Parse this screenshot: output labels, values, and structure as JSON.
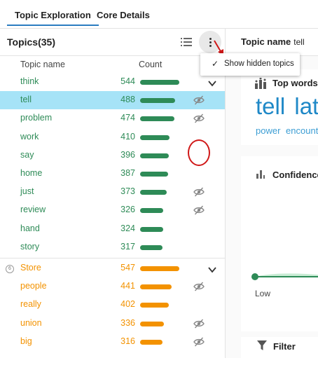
{
  "tabs": [
    {
      "label": "Topic Exploration",
      "active": true
    },
    {
      "label": "Core Details",
      "active": false
    }
  ],
  "left_panel": {
    "title": "Topics(35)",
    "columns": {
      "name": "Topic name",
      "count": "Count"
    }
  },
  "topics": [
    {
      "name": "think",
      "count": "544",
      "value": 544,
      "hidden": false,
      "selected": false,
      "expand": true
    },
    {
      "name": "tell",
      "count": "488",
      "value": 488,
      "hidden": true,
      "selected": true
    },
    {
      "name": "problem",
      "count": "474",
      "value": 474,
      "hidden": true,
      "selected": false,
      "highlighted": true
    },
    {
      "name": "work",
      "count": "410",
      "value": 410,
      "hidden": false
    },
    {
      "name": "say",
      "count": "396",
      "value": 396,
      "hidden": false
    },
    {
      "name": "home",
      "count": "387",
      "value": 387,
      "hidden": false
    },
    {
      "name": "just",
      "count": "373",
      "value": 373,
      "hidden": true
    },
    {
      "name": "review",
      "count": "326",
      "value": 326,
      "hidden": true
    },
    {
      "name": "hand",
      "count": "324",
      "value": 324,
      "hidden": false
    },
    {
      "name": "story",
      "count": "317",
      "value": 317,
      "hidden": false
    }
  ],
  "group": {
    "name": "Store",
    "count": "547",
    "value": 547,
    "icon": "group-icon",
    "expand": true
  },
  "group_topics": [
    {
      "name": "people",
      "count": "441",
      "value": 441,
      "hidden": true
    },
    {
      "name": "really",
      "count": "402",
      "value": 402,
      "hidden": false
    },
    {
      "name": "union",
      "count": "336",
      "value": 336,
      "hidden": true
    },
    {
      "name": "big",
      "count": "316",
      "value": 316,
      "hidden": true
    }
  ],
  "menu": {
    "item": "Show hidden topics",
    "checked": true
  },
  "right_panel": {
    "header_label": "Topic name",
    "header_value": "tell",
    "top_words_title": "Top words",
    "big_words": [
      "tell",
      "late"
    ],
    "small_words": [
      "power",
      "encount"
    ],
    "confidence_title": "Confidence",
    "slider_label": "Low",
    "filter_title": "Filter"
  },
  "colors": {
    "green": "#2e8b57",
    "orange": "#f39200",
    "blue_word": "#1e88c7",
    "selection": "#a6e3f7",
    "tab_underline": "#2b7cc0",
    "annotation_red": "#d01818"
  }
}
